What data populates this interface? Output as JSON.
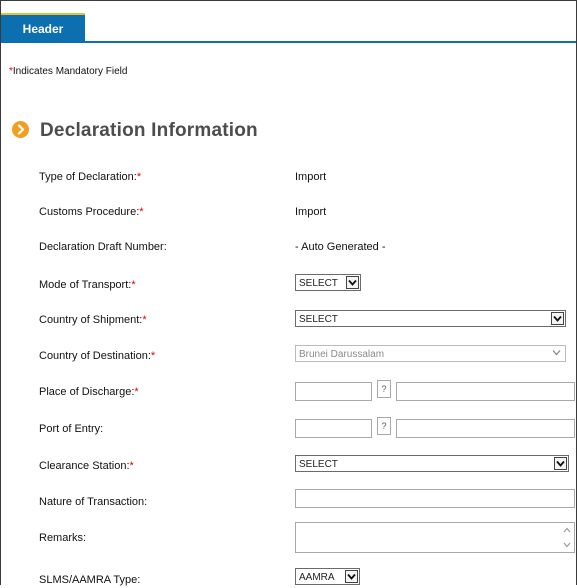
{
  "tabs": [
    {
      "label": "Header"
    }
  ],
  "mandatory_note": {
    "star": "*",
    "text": "Indicates Mandatory Field"
  },
  "section": {
    "title": "Declaration Information"
  },
  "fields": {
    "type_of_declaration": {
      "label": "Type of Declaration:",
      "required": "*",
      "value": "Import"
    },
    "customs_procedure": {
      "label": "Customs Procedure:",
      "required": "*",
      "value": "Import"
    },
    "draft_number": {
      "label": "Declaration Draft Number:",
      "value": "- Auto Generated -"
    },
    "mode_of_transport": {
      "label": "Mode of Transport:",
      "required": "*",
      "value": "SELECT"
    },
    "country_of_shipment": {
      "label": "Country of Shipment:",
      "required": "*",
      "value": "SELECT"
    },
    "country_of_destination": {
      "label": "Country of Destination:",
      "required": "*",
      "value": "Brunei Darussalam"
    },
    "place_of_discharge": {
      "label": "Place of Discharge:",
      "required": "*",
      "code": "",
      "help": "?",
      "description": ""
    },
    "port_of_entry": {
      "label": "Port of Entry:",
      "code": "",
      "help": "?",
      "description": ""
    },
    "clearance_station": {
      "label": "Clearance Station:",
      "required": "*",
      "value": "SELECT"
    },
    "nature_of_transaction": {
      "label": "Nature of Transaction:",
      "value": ""
    },
    "remarks": {
      "label": "Remarks:",
      "value": ""
    },
    "slms_aamra_type": {
      "label": "SLMS/AAMRA Type:",
      "value": "AAMRA"
    }
  },
  "colors": {
    "tab": "#0b6fb0",
    "required": "#dd0000",
    "section_icon": "#f0a01e"
  }
}
